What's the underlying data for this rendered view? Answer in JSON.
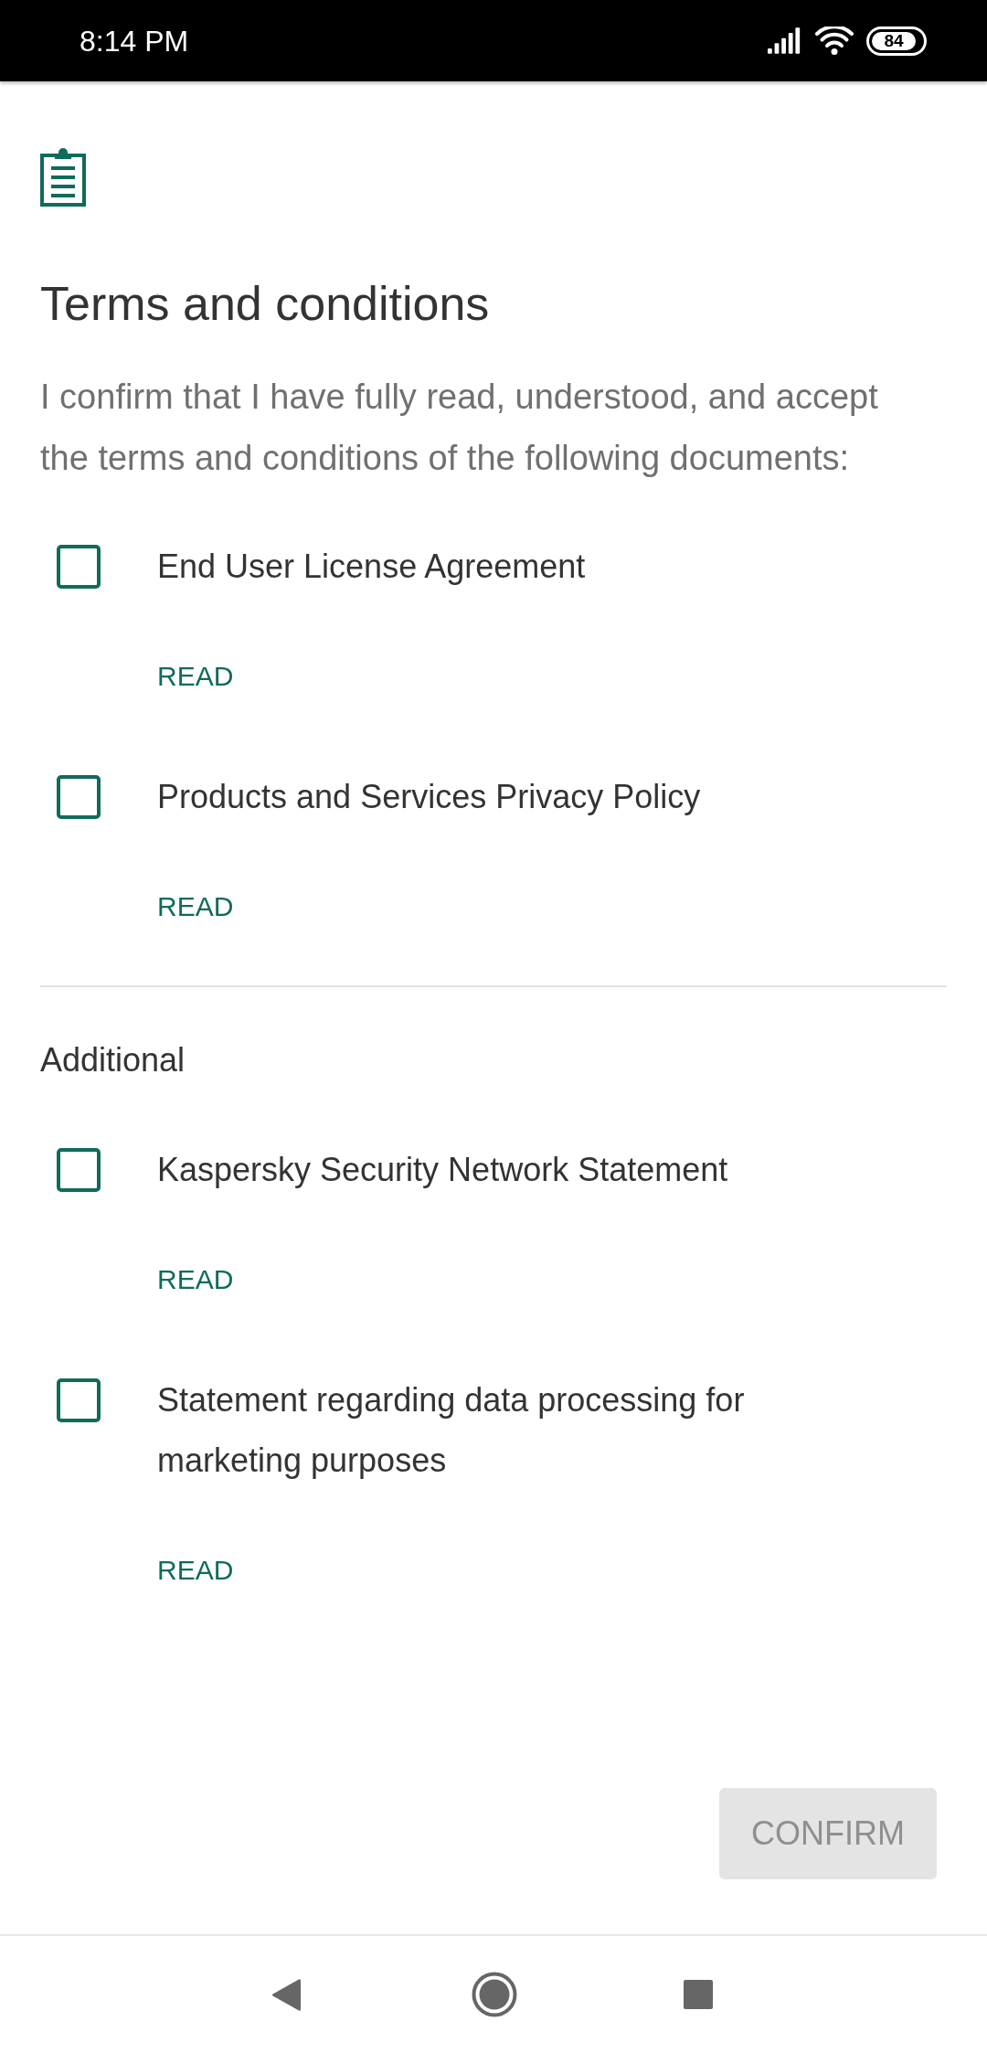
{
  "status_bar": {
    "time": "8:14 PM",
    "battery": "84"
  },
  "title": "Terms and conditions",
  "description": "I confirm that I have fully read, understood, and accept the terms and conditions of the following documents:",
  "documents": [
    {
      "label": "End User License Agreement",
      "checked": false,
      "link": "READ"
    },
    {
      "label": "Products and Services Privacy Policy",
      "checked": false,
      "link": "READ"
    }
  ],
  "additional": {
    "heading": "Additional",
    "documents": [
      {
        "label": "Kaspersky Security Network Statement",
        "checked": false,
        "link": "READ"
      },
      {
        "label": "Statement regarding data processing for marketing purposes",
        "checked": false,
        "link": "READ"
      }
    ]
  },
  "confirm_button": {
    "label": "CONFIRM",
    "disabled": true
  }
}
